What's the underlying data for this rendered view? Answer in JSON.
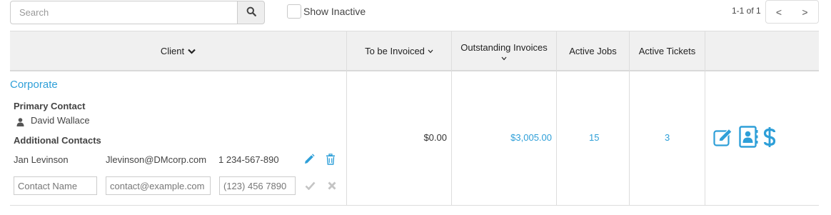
{
  "toolbar": {
    "search_placeholder": "Search",
    "show_inactive_label": "Show Inactive",
    "show_inactive_checked": false,
    "pager_text": "1-1 of 1",
    "prev_label": "<",
    "next_label": ">"
  },
  "table": {
    "headers": {
      "client": "Client",
      "to_be_invoiced": "To be Invoiced",
      "outstanding_line1": "Outstanding Invoices",
      "active_jobs": "Active Jobs",
      "active_tickets": "Active Tickets"
    },
    "row": {
      "client_name": "Corporate",
      "primary_label": "Primary Contact",
      "primary_name": "David Wallace",
      "additional_label": "Additional Contacts",
      "contacts": [
        {
          "name": "Jan Levinson",
          "email": "Jlevinson@DMcorp.com",
          "phone": "1 234-567-890"
        }
      ],
      "new_contact": {
        "name_placeholder": "Contact Name",
        "email_placeholder": "contact@example.com",
        "phone_placeholder": "(123) 456 7890"
      },
      "to_be_invoiced": "$0.00",
      "outstanding": "$3,005.00",
      "active_jobs": "15",
      "active_tickets": "3"
    }
  },
  "icons": {
    "search": "search-icon",
    "person": "user-icon",
    "edit_contact": "pencil-icon",
    "delete_contact": "trash-icon",
    "confirm": "check-icon",
    "cancel": "close-icon",
    "edit_client": "edit-icon",
    "contacts_book": "address-book-icon",
    "billing": "dollar-icon"
  },
  "colors": {
    "accent": "#2e9fd8",
    "header_bg": "#f0f0f0",
    "border": "#dddddd"
  }
}
